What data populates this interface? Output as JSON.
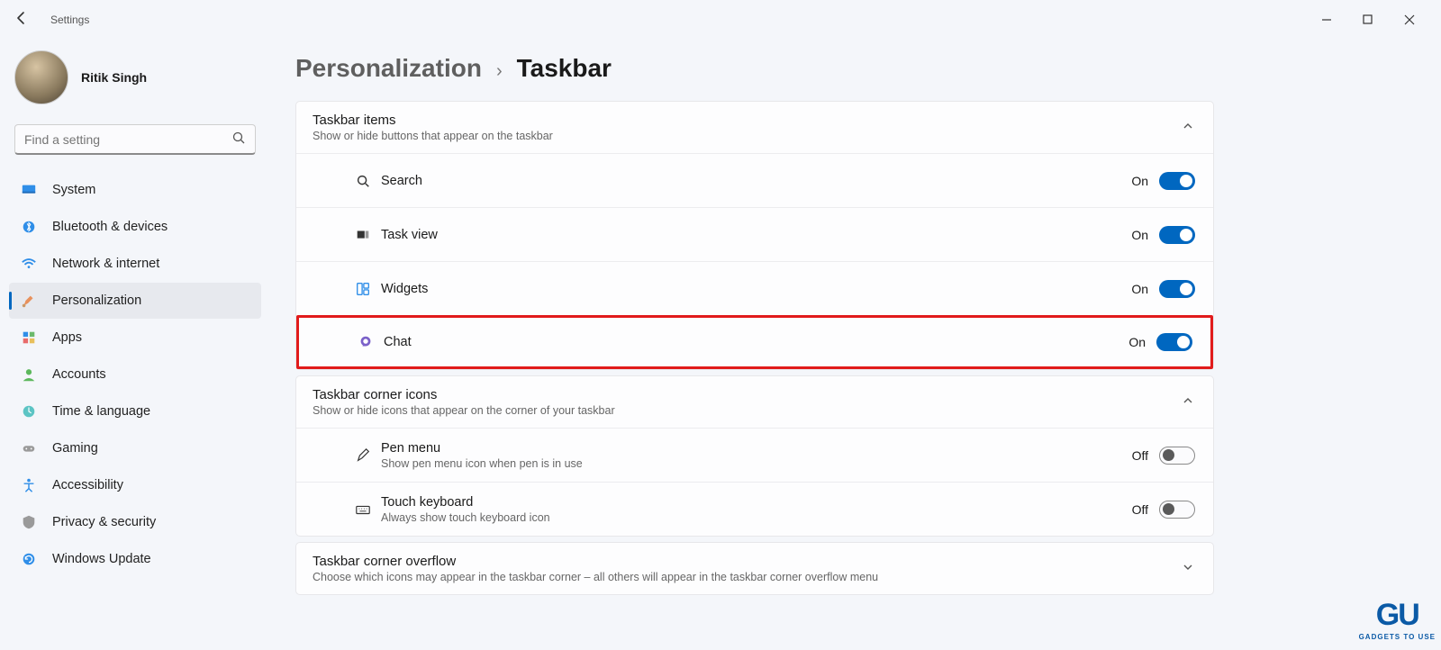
{
  "app_title": "Settings",
  "user_name": "Ritik Singh",
  "search_placeholder": "Find a setting",
  "breadcrumb": {
    "parent": "Personalization",
    "current": "Taskbar"
  },
  "nav": [
    {
      "label": "System"
    },
    {
      "label": "Bluetooth & devices"
    },
    {
      "label": "Network & internet"
    },
    {
      "label": "Personalization"
    },
    {
      "label": "Apps"
    },
    {
      "label": "Accounts"
    },
    {
      "label": "Time & language"
    },
    {
      "label": "Gaming"
    },
    {
      "label": "Accessibility"
    },
    {
      "label": "Privacy & security"
    },
    {
      "label": "Windows Update"
    }
  ],
  "sections": {
    "items": {
      "title": "Taskbar items",
      "sub": "Show or hide buttons that appear on the taskbar",
      "rows": [
        {
          "label": "Search",
          "state": "On"
        },
        {
          "label": "Task view",
          "state": "On"
        },
        {
          "label": "Widgets",
          "state": "On"
        },
        {
          "label": "Chat",
          "state": "On"
        }
      ]
    },
    "corner_icons": {
      "title": "Taskbar corner icons",
      "sub": "Show or hide icons that appear on the corner of your taskbar",
      "rows": [
        {
          "label": "Pen menu",
          "sub": "Show pen menu icon when pen is in use",
          "state": "Off"
        },
        {
          "label": "Touch keyboard",
          "sub": "Always show touch keyboard icon",
          "state": "Off"
        }
      ]
    },
    "overflow": {
      "title": "Taskbar corner overflow",
      "sub": "Choose which icons may appear in the taskbar corner – all others will appear in the taskbar corner overflow menu"
    }
  },
  "watermark": {
    "logo": "GU",
    "sub": "GADGETS TO USE"
  }
}
